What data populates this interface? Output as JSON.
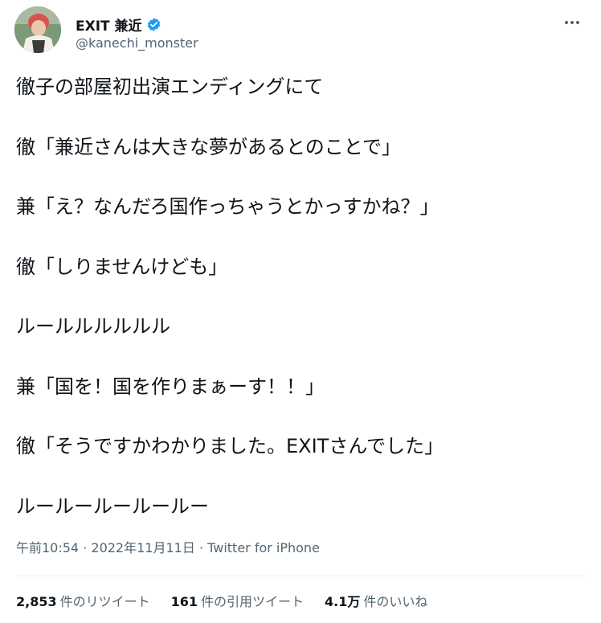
{
  "author": {
    "display_name": "EXIT 兼近",
    "handle": "@kanechi_monster"
  },
  "icons": {
    "avatar": "avatar",
    "verified": "verified-badge-icon",
    "more": "more-options-icon"
  },
  "colors": {
    "text": "#0f1419",
    "secondary": "#536471",
    "verified": "#1d9bf0"
  },
  "tweet": {
    "lines": [
      "徹子の部屋初出演エンディングにて",
      "徹「兼近さんは大きな夢があるとのことで」",
      "兼「え？なんだろ国作っちゃうとかっすかね？」",
      "徹「しりませんけども」",
      "ルールルルルルル",
      "兼「国を！国を作りまぁーす！！」",
      "徹「そうですかわかりました。EXITさんでした」",
      "ルールールールールー"
    ]
  },
  "meta": {
    "time": "午前10:54",
    "sep1": " · ",
    "date": "2022年11月11日",
    "sep2": " · ",
    "source": "Twitter for iPhone"
  },
  "stats": {
    "retweets": {
      "count": "2,853",
      "label": "件のリツイート"
    },
    "quotes": {
      "count": "161",
      "label": "件の引用ツイート"
    },
    "likes": {
      "count": "4.1万",
      "label": "件のいいね"
    }
  }
}
